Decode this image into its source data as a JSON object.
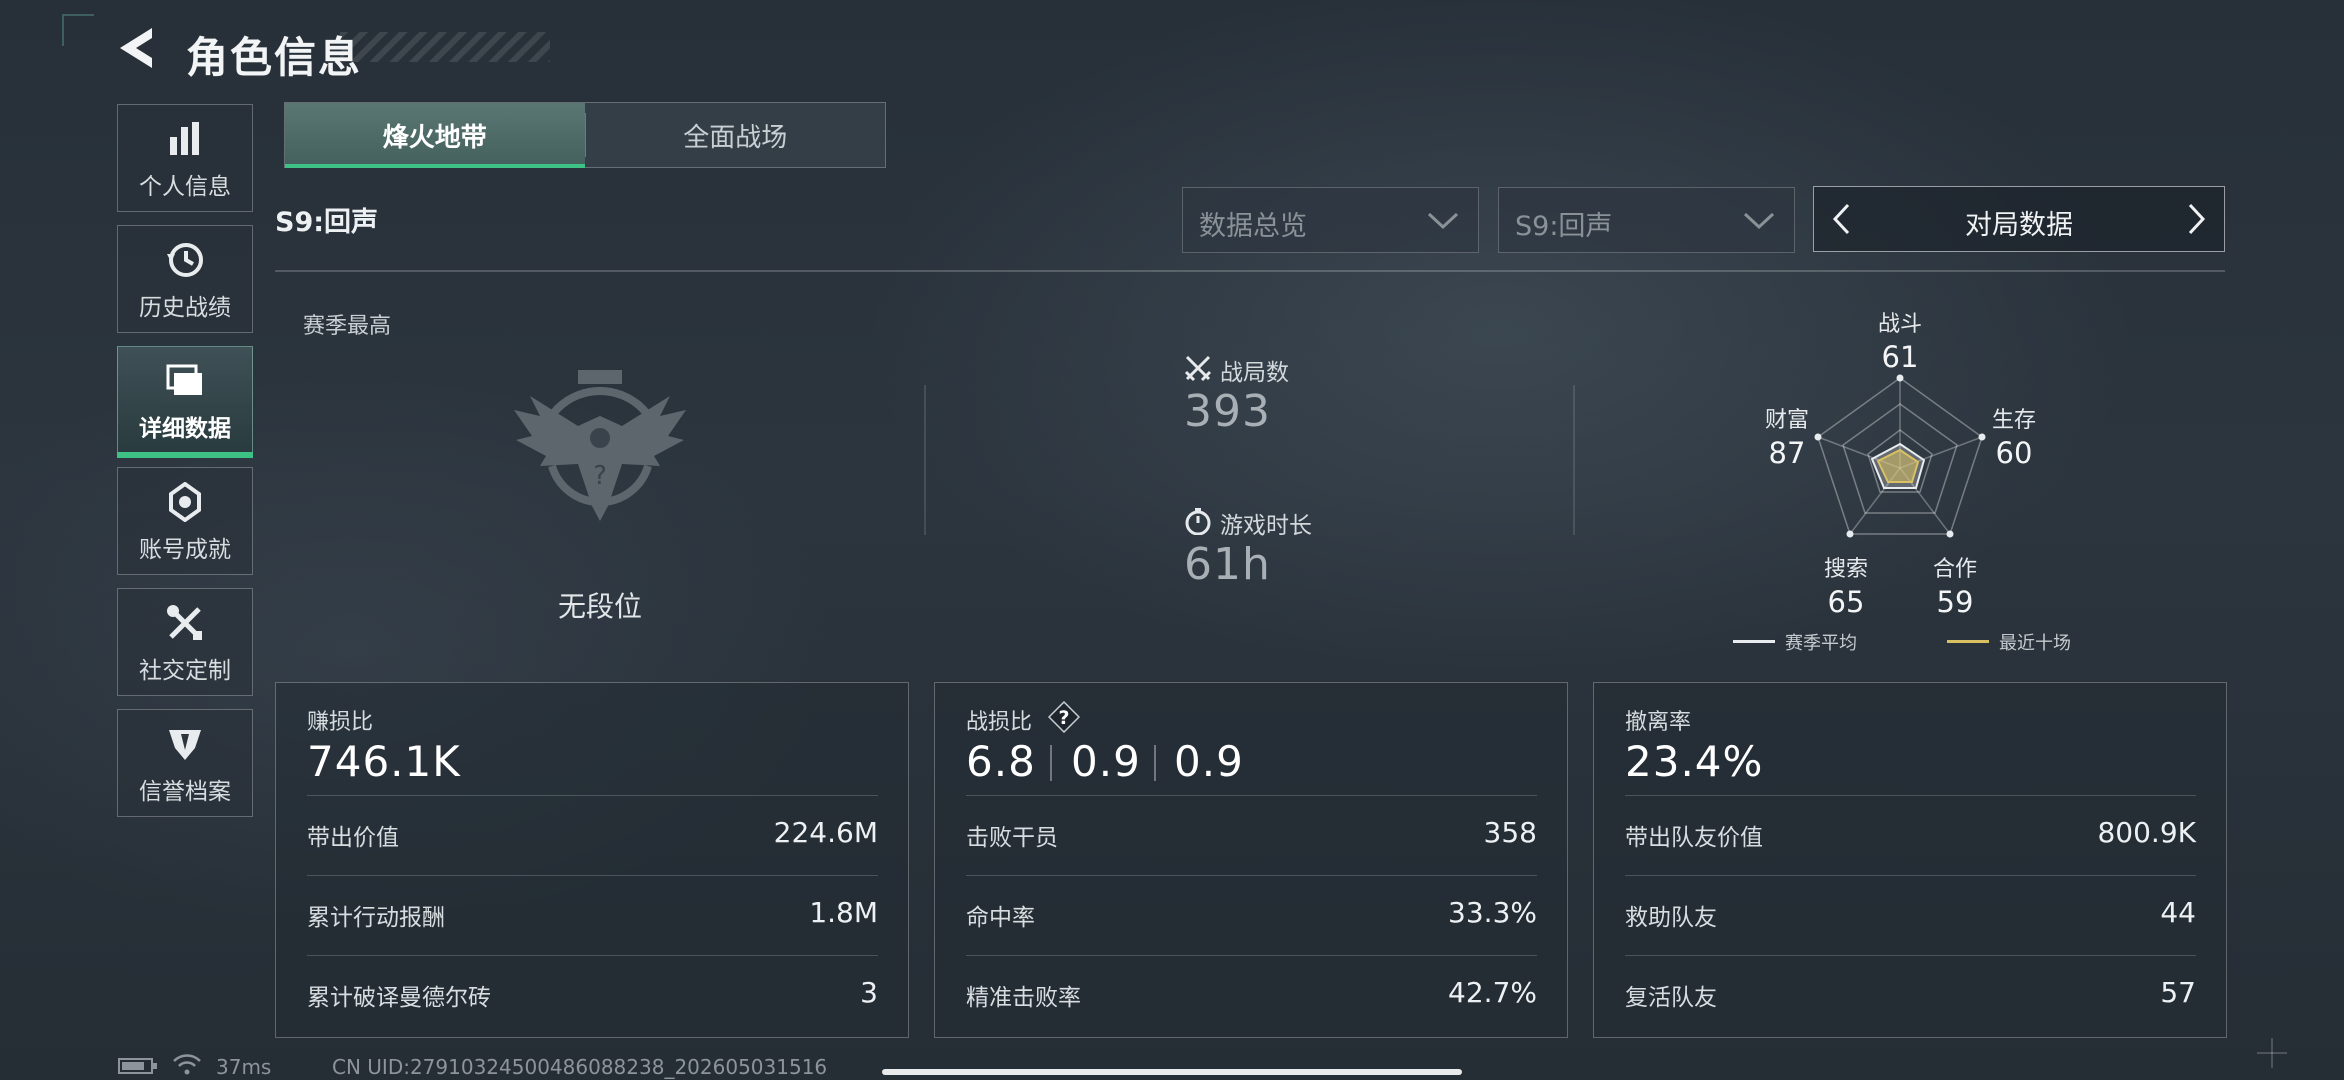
{
  "header": {
    "title": "角色信息"
  },
  "sidebar": {
    "items": [
      {
        "label": "个人信息",
        "icon": "bar-chart-icon",
        "active": false
      },
      {
        "label": "历史战绩",
        "icon": "history-icon",
        "active": false
      },
      {
        "label": "详细数据",
        "icon": "folder-icon",
        "active": true
      },
      {
        "label": "账号成就",
        "icon": "medal-icon",
        "active": false
      },
      {
        "label": "社交定制",
        "icon": "tools-icon",
        "active": false
      },
      {
        "label": "信誉档案",
        "icon": "credit-shield-icon",
        "active": false
      }
    ]
  },
  "tabs": [
    {
      "label": "烽火地带",
      "active": true
    },
    {
      "label": "全面战场",
      "active": false
    }
  ],
  "season": {
    "label": "S9:回声"
  },
  "filters": {
    "dropdown1": "数据总览",
    "dropdown2": "S9:回声",
    "pager_label": "对局数据"
  },
  "overview": {
    "season_best_label": "赛季最高",
    "rank_text": "无段位",
    "matches_label": "战局数",
    "matches_value": "393",
    "playtime_label": "游戏时长",
    "playtime_value": "61h"
  },
  "radar": {
    "axes": [
      {
        "label": "战斗",
        "value": "61"
      },
      {
        "label": "生存",
        "value": "60"
      },
      {
        "label": "合作",
        "value": "59"
      },
      {
        "label": "搜索",
        "value": "65"
      },
      {
        "label": "财富",
        "value": "87"
      }
    ],
    "legend": [
      {
        "label": "赛季平均",
        "color": "#e9ecee"
      },
      {
        "label": "最近十场",
        "color": "#d8c063"
      }
    ]
  },
  "cards": {
    "profit": {
      "label": "赚损比",
      "value": "746.1K",
      "rows": [
        {
          "k": "带出价值",
          "v": "224.6M"
        },
        {
          "k": "累计行动报酬",
          "v": "1.8M"
        },
        {
          "k": "累计破译曼德尔砖",
          "v": "3"
        }
      ]
    },
    "combat": {
      "label": "战损比",
      "values": [
        "6.8",
        "0.9",
        "0.9"
      ],
      "rows": [
        {
          "k": "击败干员",
          "v": "358"
        },
        {
          "k": "命中率",
          "v": "33.3%"
        },
        {
          "k": "精准击败率",
          "v": "42.7%"
        }
      ]
    },
    "extract": {
      "label": "撤离率",
      "value": "23.4%",
      "rows": [
        {
          "k": "带出队友价值",
          "v": "800.9K"
        },
        {
          "k": "救助队友",
          "v": "44"
        },
        {
          "k": "复活队友",
          "v": "57"
        }
      ]
    }
  },
  "footer": {
    "ping": "37ms",
    "uid": "CN UID:279103245004860882​38_202605031516"
  },
  "colors": {
    "accent": "#3ec184",
    "recent": "#d8c063"
  }
}
